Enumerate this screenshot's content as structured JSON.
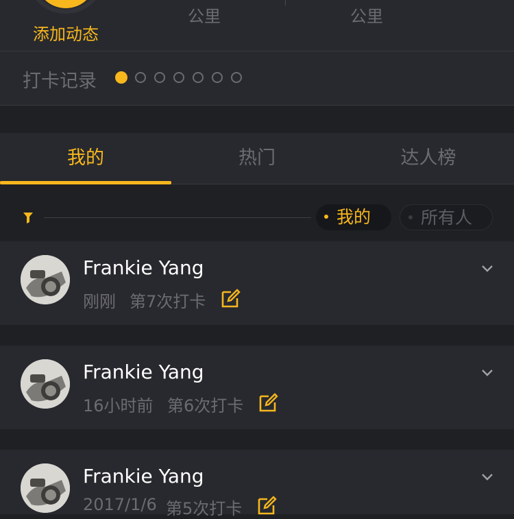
{
  "header": {
    "add_label": "添加动态",
    "unit_left": "公里",
    "unit_right": "公里"
  },
  "record": {
    "label": "打卡记录",
    "dots_total": 7,
    "active_index": 0
  },
  "tabs": [
    {
      "label": "我的",
      "active": true
    },
    {
      "label": "热门",
      "active": false
    },
    {
      "label": "达人榜",
      "active": false
    }
  ],
  "filter": {
    "mine_label": "我的",
    "all_label": "所有人"
  },
  "feed": [
    {
      "name": "Frankie Yang",
      "time": "刚刚",
      "count": "第7次打卡"
    },
    {
      "name": "Frankie Yang",
      "time": "16小时前",
      "count": "第6次打卡"
    },
    {
      "name": "Frankie Yang",
      "time": "2017/1/6",
      "count": "第5次打卡"
    }
  ],
  "colors": {
    "accent": "#f7b71d",
    "background": "#1f2024",
    "card": "#28292e",
    "muted_text": "#6b6c72"
  }
}
